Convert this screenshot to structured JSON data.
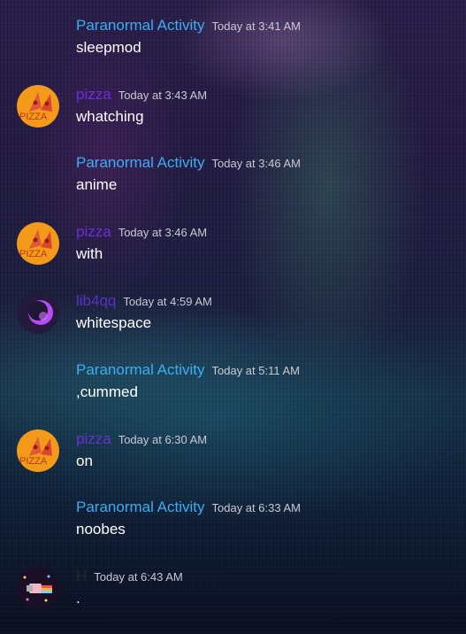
{
  "colors": {
    "paranormal": "#3aaef2",
    "pizza": "#6a2fd6",
    "lib4qq": "#5a32c8",
    "h": "#1e2a2c",
    "text": "#ffffff",
    "timestamp": "#c9c9d2"
  },
  "messages": [
    {
      "author": "Paranormal Activity",
      "time": "Today at 3:41 AM",
      "text": "sleepmod",
      "avatar": null
    },
    {
      "author": "pizza",
      "time": "Today at 3:43 AM",
      "text": "whatching",
      "avatar": "pizza-avatar"
    },
    {
      "author": "Paranormal Activity",
      "time": "Today at 3:46 AM",
      "text": "anime",
      "avatar": null
    },
    {
      "author": "pizza",
      "time": "Today at 3:46 AM",
      "text": "with",
      "avatar": "pizza-avatar"
    },
    {
      "author": "lib4qq",
      "time": "Today at 4:59 AM",
      "text": "whitespace",
      "avatar": "purple-moon-avatar"
    },
    {
      "author": "Paranormal Activity",
      "time": "Today at 5:11 AM",
      "text": ",cummed",
      "avatar": null
    },
    {
      "author": "pizza",
      "time": "Today at 6:30 AM",
      "text": "on",
      "avatar": "pizza-avatar"
    },
    {
      "author": "Paranormal Activity",
      "time": "Today at 6:33 AM",
      "text": "noobes",
      "avatar": null
    },
    {
      "author": "H",
      "time": "Today at 6:43 AM",
      "text": ".",
      "avatar": "nyan-cat-avatar"
    }
  ]
}
